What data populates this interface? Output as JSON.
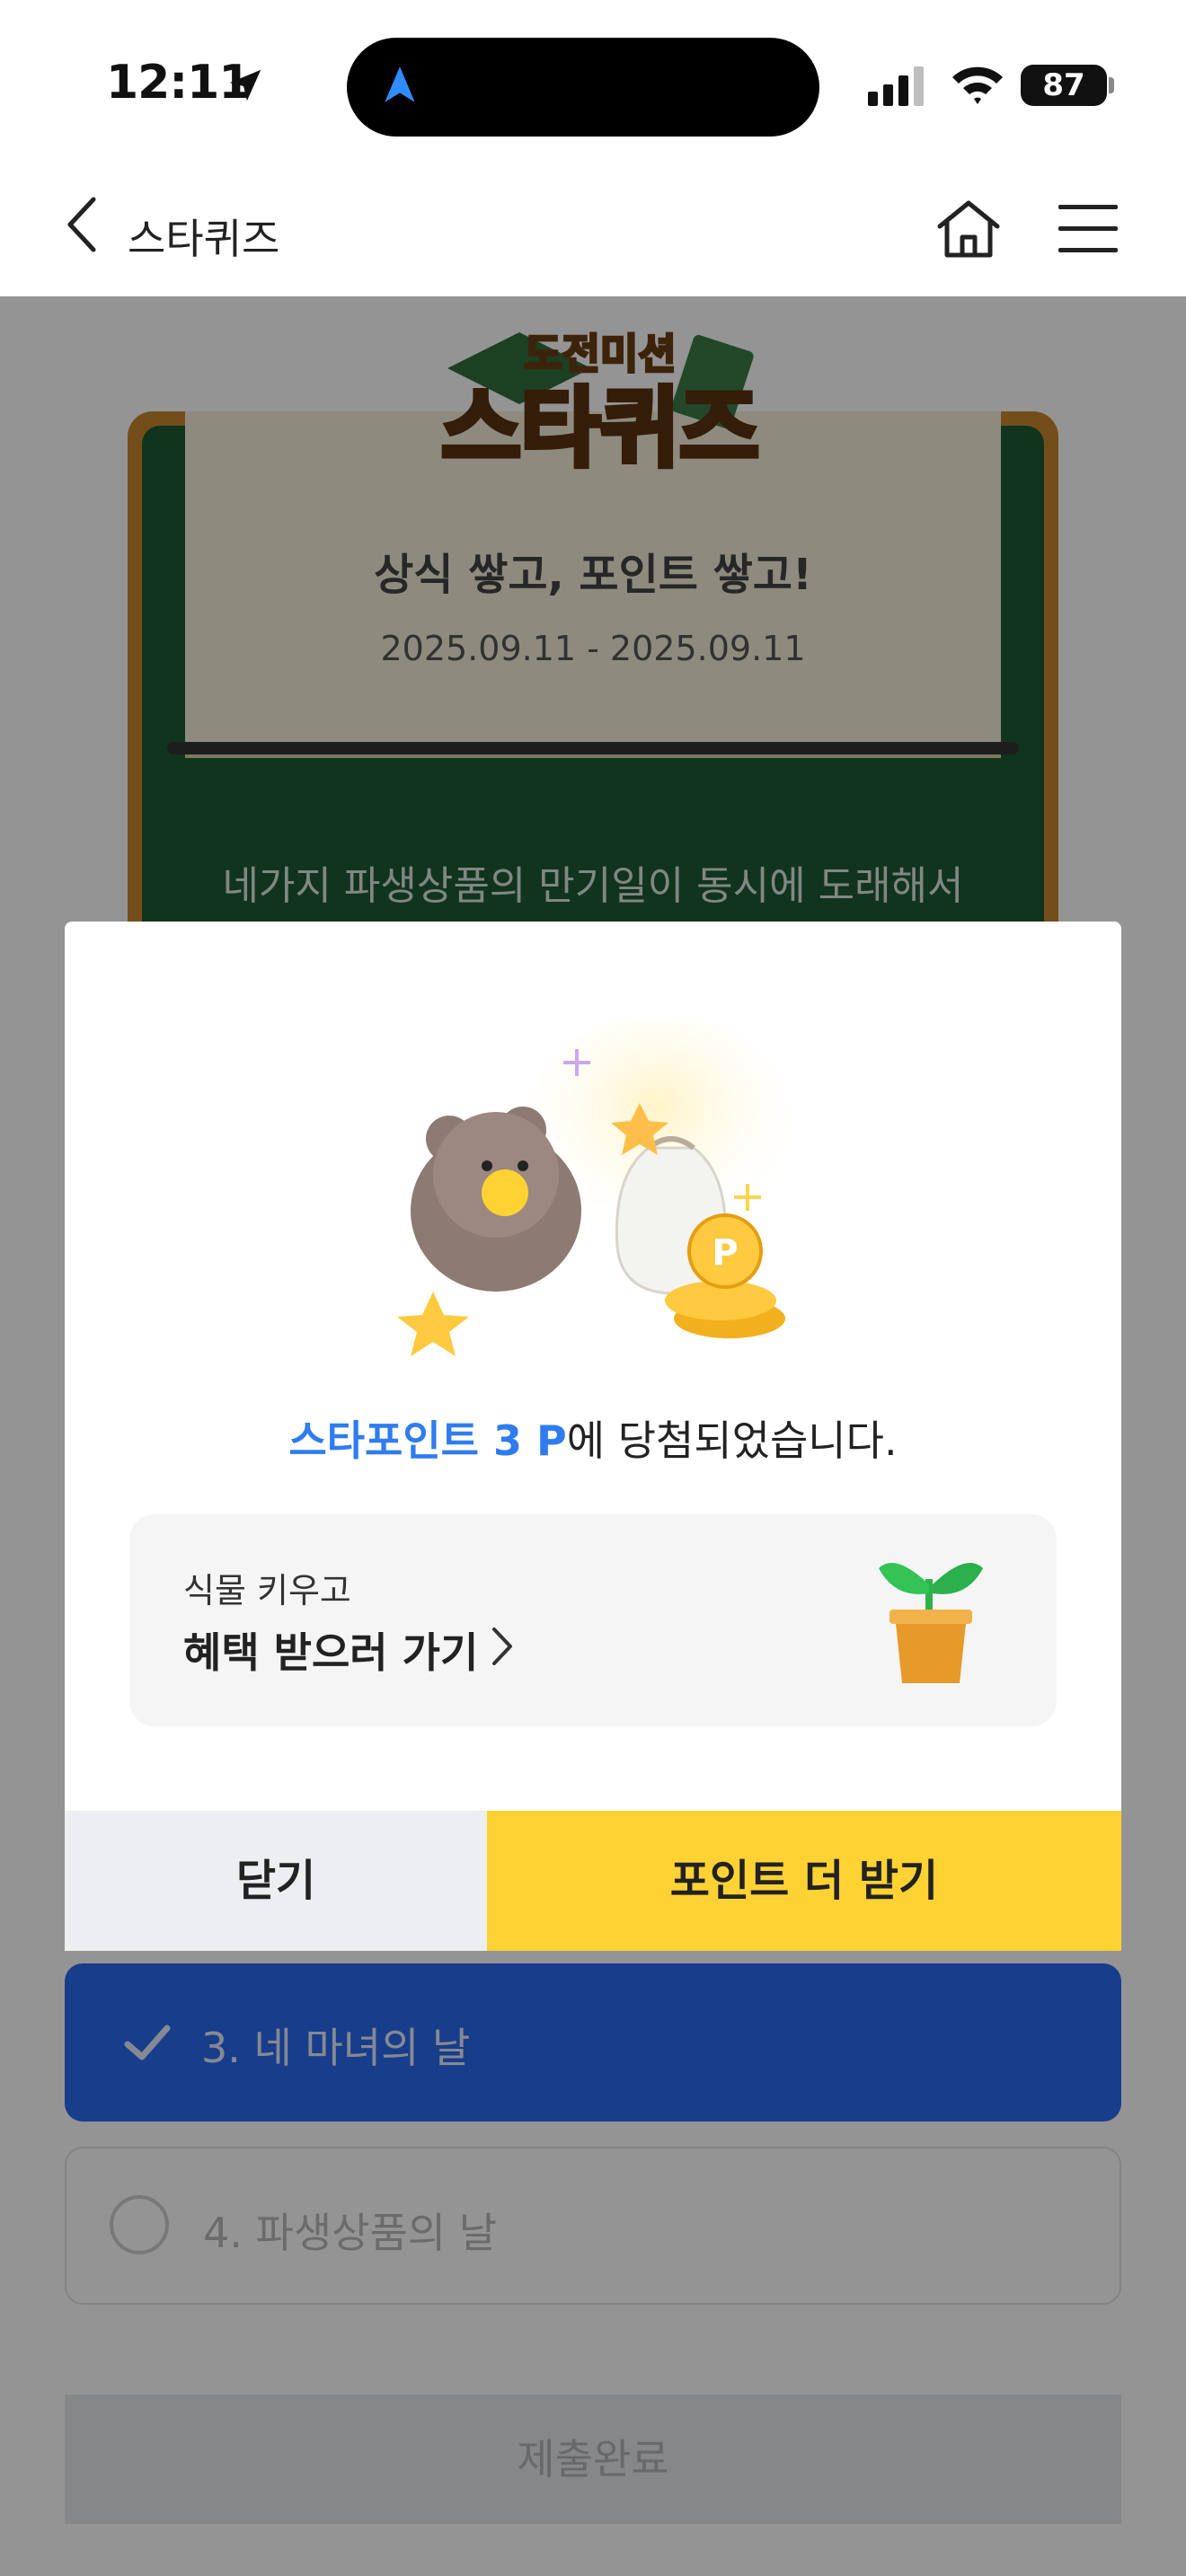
{
  "status_bar": {
    "time": "12:11",
    "battery": "87"
  },
  "header": {
    "title": "스타퀴즈"
  },
  "event": {
    "logo_line1": "도전미션",
    "logo_line2": "스타퀴즈",
    "subtitle": "상식 쌓고, 포인트 쌓고!",
    "date_range": "2025.09.11 - 2025.09.11",
    "question": "네가지 파생상품의 만기일이 동시에 도래해서"
  },
  "options": [
    {
      "label": "3. 네 마녀의 날",
      "selected": true
    },
    {
      "label": "4. 파생상품의 날",
      "selected": false
    }
  ],
  "submit_label": "제출완료",
  "modal": {
    "message_highlight": "스타포인트 3 P",
    "message_rest": "에 당첨되었습니다.",
    "benefit_small": "식물 키우고",
    "benefit_big": "혜택 받으러 가기",
    "close_label": "닫기",
    "more_label": "포인트 더 받기"
  },
  "colors": {
    "accent_blue": "#2f7cf0",
    "button_yellow": "#ffd233",
    "board_green": "#1e5a35"
  }
}
